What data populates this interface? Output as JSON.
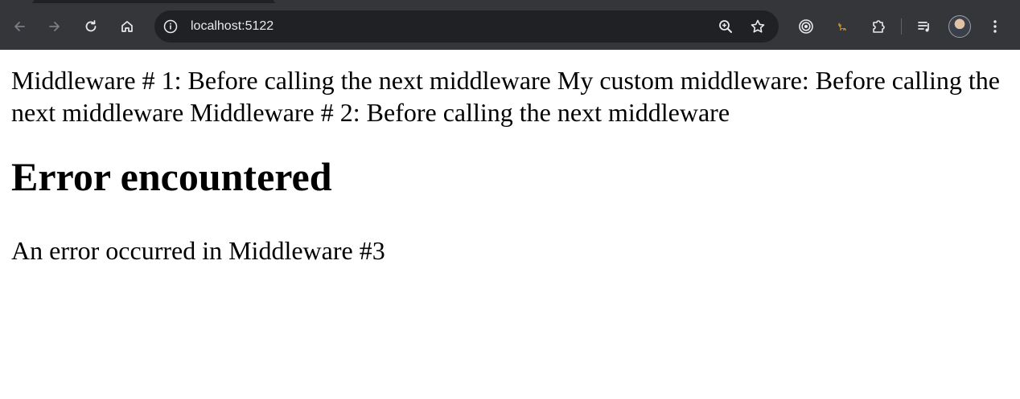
{
  "browser": {
    "url": "localhost:5122",
    "icons": {
      "back": "arrow-left-icon",
      "forward": "arrow-right-icon",
      "reload": "reload-icon",
      "home": "home-icon",
      "site_info": "info-icon",
      "zoom": "zoom-icon",
      "bookmark": "star-icon",
      "extension1": "target-icon",
      "extension2": "animal-icon",
      "extensions": "puzzle-icon",
      "media": "playlist-icon",
      "profile": "avatar-icon",
      "menu": "kebab-menu-icon"
    },
    "colors": {
      "toolbar": "#35363a",
      "omnibox": "#202124",
      "icon": "#e8eaed"
    }
  },
  "page": {
    "log_text": "Middleware # 1: Before calling the next middleware My custom middleware: Before calling the next middleware Middleware # 2: Before calling the next middleware",
    "heading": "Error encountered",
    "error_message": "An error occurred in Middleware #3"
  }
}
